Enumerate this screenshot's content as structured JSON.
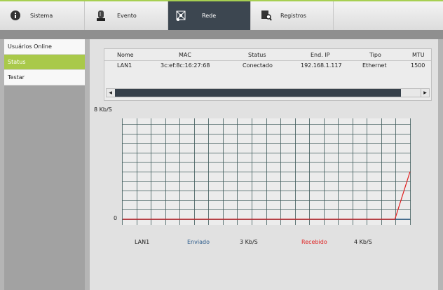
{
  "tabs": [
    {
      "label": "Sistema",
      "icon": "info-icon"
    },
    {
      "label": "Evento",
      "icon": "siren-icon"
    },
    {
      "label": "Rede",
      "icon": "network-icon"
    },
    {
      "label": "Registros",
      "icon": "magnifier-icon"
    }
  ],
  "active_tab": "Rede",
  "sidebar": {
    "items": [
      {
        "label": "Usuários Online"
      },
      {
        "label": "Status"
      },
      {
        "label": "Testar"
      }
    ],
    "active": "Status"
  },
  "table": {
    "headers": [
      "Nome",
      "MAC",
      "Status",
      "End. IP",
      "Tipo",
      "MTU"
    ],
    "rows": [
      [
        "LAN1",
        "3c:ef:8c:16:27:68",
        "Conectado",
        "192.168.1.117",
        "Ethernet",
        "1500"
      ]
    ]
  },
  "chart": {
    "y_max_label": "8 Kb/S",
    "y_min_label": "0"
  },
  "chart_data": {
    "type": "line",
    "ylabel_top": "8 Kb/S",
    "ylim": [
      0,
      8
    ],
    "grid": true,
    "points": 20,
    "series": [
      {
        "name": "Enviado",
        "color": "#2a5a8a",
        "values": [
          0,
          0,
          0,
          0,
          0,
          0,
          0,
          0,
          0,
          0,
          0,
          0,
          0,
          0,
          0,
          0,
          0,
          0,
          0,
          0
        ]
      },
      {
        "name": "Recebido",
        "color": "#e01e1e",
        "values": [
          0,
          0,
          0,
          0,
          0,
          0,
          0,
          0,
          0,
          0,
          0,
          0,
          0,
          0,
          0,
          0,
          0,
          0,
          0,
          4
        ]
      }
    ]
  },
  "legend": {
    "iface": "LAN1",
    "sent_label": "Enviado",
    "sent_value": "3 Kb/S",
    "recv_label": "Recebido",
    "recv_value": "4 Kb/S"
  },
  "colors": {
    "accent": "#a9c94a",
    "active_tab": "#3c4650",
    "sent": "#2a5a8a",
    "recv": "#e01e1e"
  }
}
